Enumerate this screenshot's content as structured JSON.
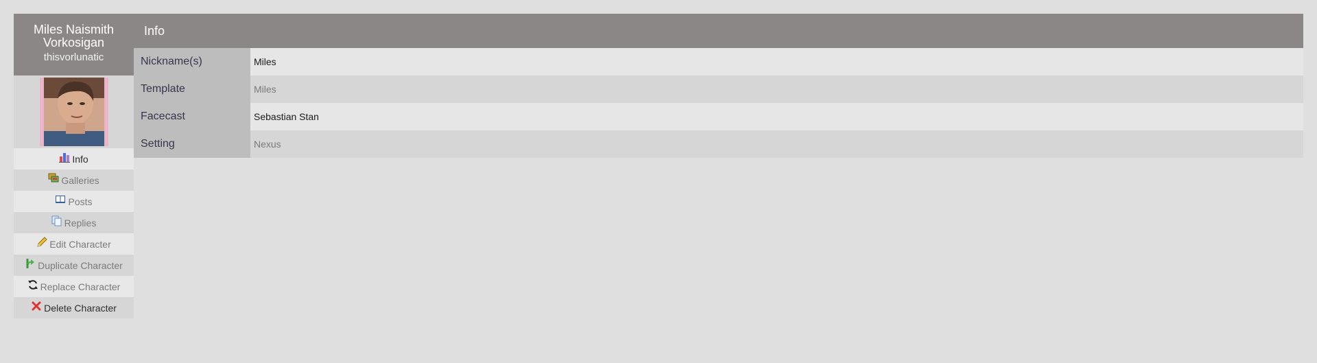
{
  "character": {
    "name": "Miles Naismith Vorkosigan",
    "username": "thisvorlunatic"
  },
  "nav": {
    "items": [
      {
        "label": "Info",
        "icon": "chart-icon"
      },
      {
        "label": "Galleries",
        "icon": "images-icon"
      },
      {
        "label": "Posts",
        "icon": "book-icon"
      },
      {
        "label": "Replies",
        "icon": "pages-icon"
      },
      {
        "label": "Edit Character",
        "icon": "pencil-icon"
      },
      {
        "label": "Duplicate Character",
        "icon": "fork-arrow-icon"
      },
      {
        "label": "Replace Character",
        "icon": "refresh-icon"
      },
      {
        "label": "Delete Character",
        "icon": "delete-x-icon"
      }
    ]
  },
  "main": {
    "title": "Info",
    "rows": [
      {
        "key": "Nickname(s)",
        "value": "Miles"
      },
      {
        "key": "Template",
        "value": "Miles"
      },
      {
        "key": "Facecast",
        "value": "Sebastian Stan"
      },
      {
        "key": "Setting",
        "value": "Nexus"
      }
    ]
  },
  "colors": {
    "header_bg": "#8b8787",
    "page_bg": "#dfdfdf",
    "key_bg": "#bdbdbd"
  }
}
